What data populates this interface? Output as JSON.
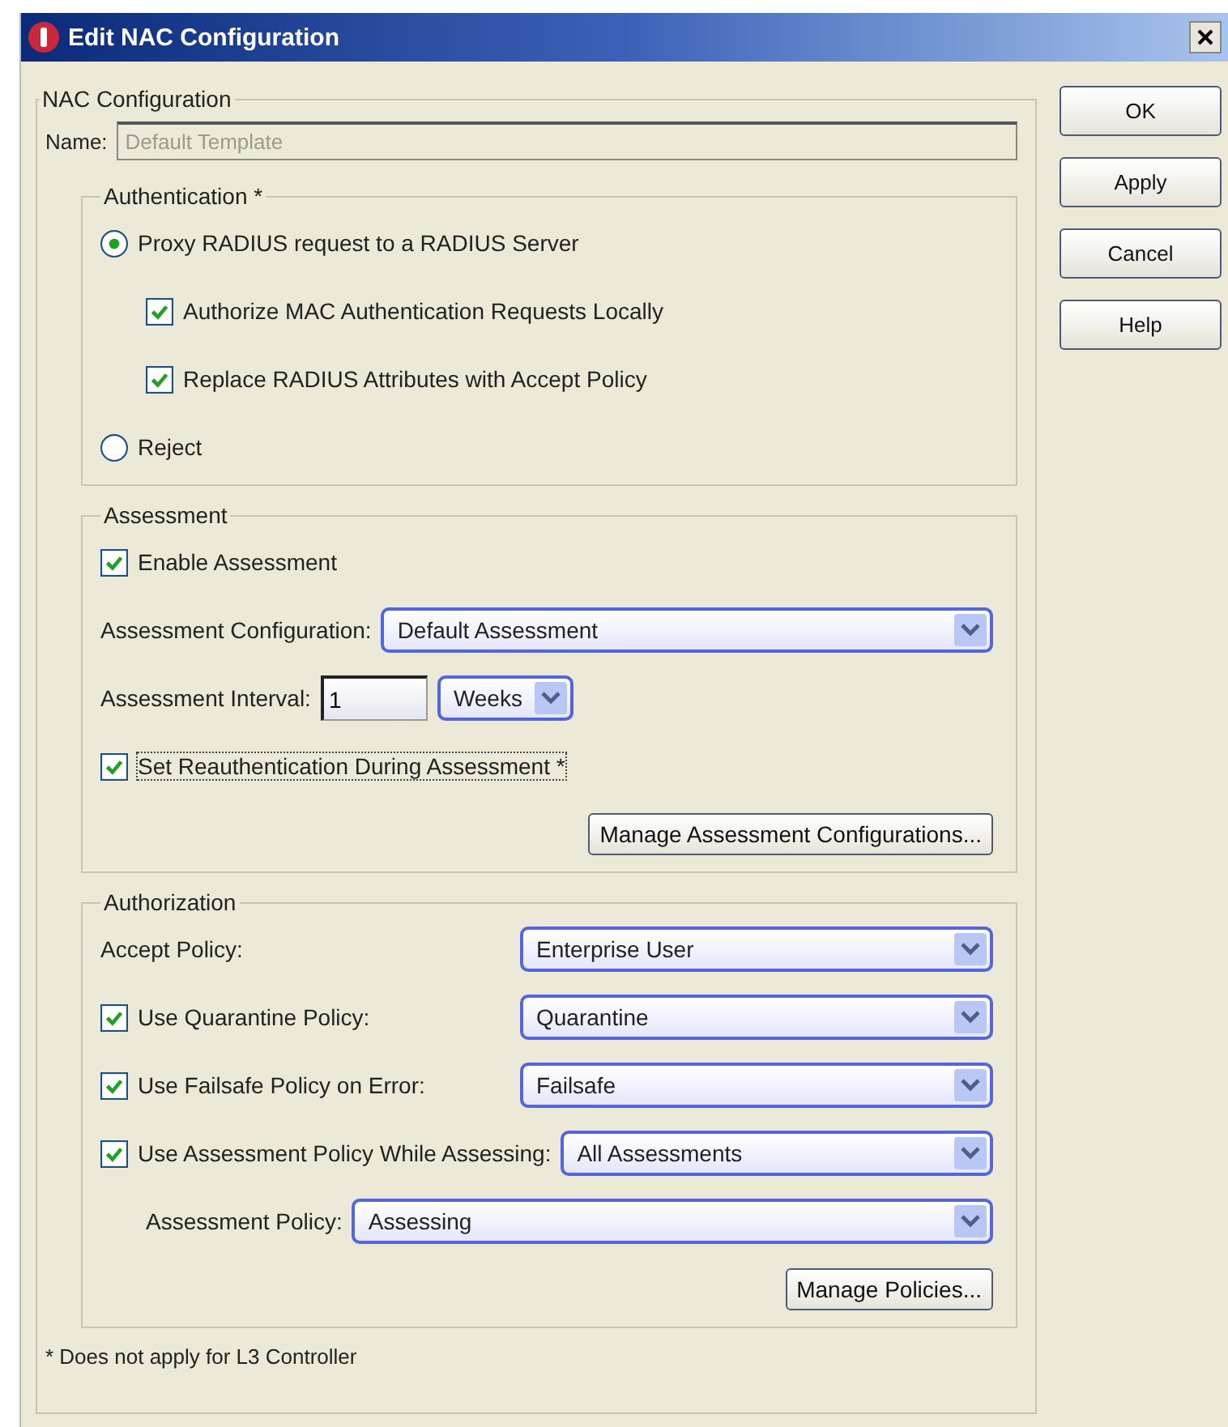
{
  "window": {
    "title": "Edit NAC Configuration"
  },
  "config": {
    "legend": "NAC Configuration",
    "name": {
      "label": "Name:",
      "value": "Default Template",
      "disabled": true
    },
    "sections": [
      {
        "legend": "Authentication *",
        "items": [
          {
            "kind": "radio",
            "label": "Proxy RADIUS request to a RADIUS Server",
            "selected": true,
            "children": [
              {
                "kind": "checkbox",
                "label": "Authorize MAC Authentication Requests Locally",
                "checked": true
              },
              {
                "kind": "checkbox",
                "label": "Replace RADIUS Attributes with Accept Policy",
                "checked": true
              }
            ]
          },
          {
            "kind": "radio",
            "label": "Reject",
            "selected": false
          }
        ]
      },
      {
        "legend": "Assessment",
        "items": [
          {
            "kind": "checkbox",
            "label": "Enable Assessment",
            "checked": true
          },
          {
            "kind": "select",
            "label": "Assessment Configuration:",
            "value": "Default Assessment"
          },
          {
            "kind": "interval",
            "label": "Assessment Interval:",
            "value": "1",
            "unit": "Weeks"
          },
          {
            "kind": "checkbox",
            "label": "Set Reauthentication During Assessment *",
            "checked": true,
            "focused": true
          },
          {
            "kind": "button",
            "label": "Manage Assessment Configurations..."
          }
        ]
      },
      {
        "legend": "Authorization",
        "items": [
          {
            "kind": "policy",
            "label": "Accept Policy:",
            "value": "Enterprise User"
          },
          {
            "kind": "policy",
            "label": "Use Quarantine Policy:",
            "checked": true,
            "value": "Quarantine"
          },
          {
            "kind": "policy",
            "label": "Use Failsafe Policy on Error:",
            "checked": true,
            "value": "Failsafe"
          },
          {
            "kind": "policy",
            "label": "Use Assessment Policy While Assessing:",
            "checked": true,
            "value": "All Assessments",
            "children": [
              {
                "kind": "select",
                "label": "Assessment Policy:",
                "value": "Assessing"
              }
            ]
          },
          {
            "kind": "button",
            "label": "Manage Policies..."
          }
        ]
      }
    ],
    "footnote": "* Does not apply for L3 Controller"
  },
  "buttons": [
    {
      "label": "OK"
    },
    {
      "label": "Apply"
    },
    {
      "label": "Cancel"
    },
    {
      "label": "Help"
    }
  ]
}
